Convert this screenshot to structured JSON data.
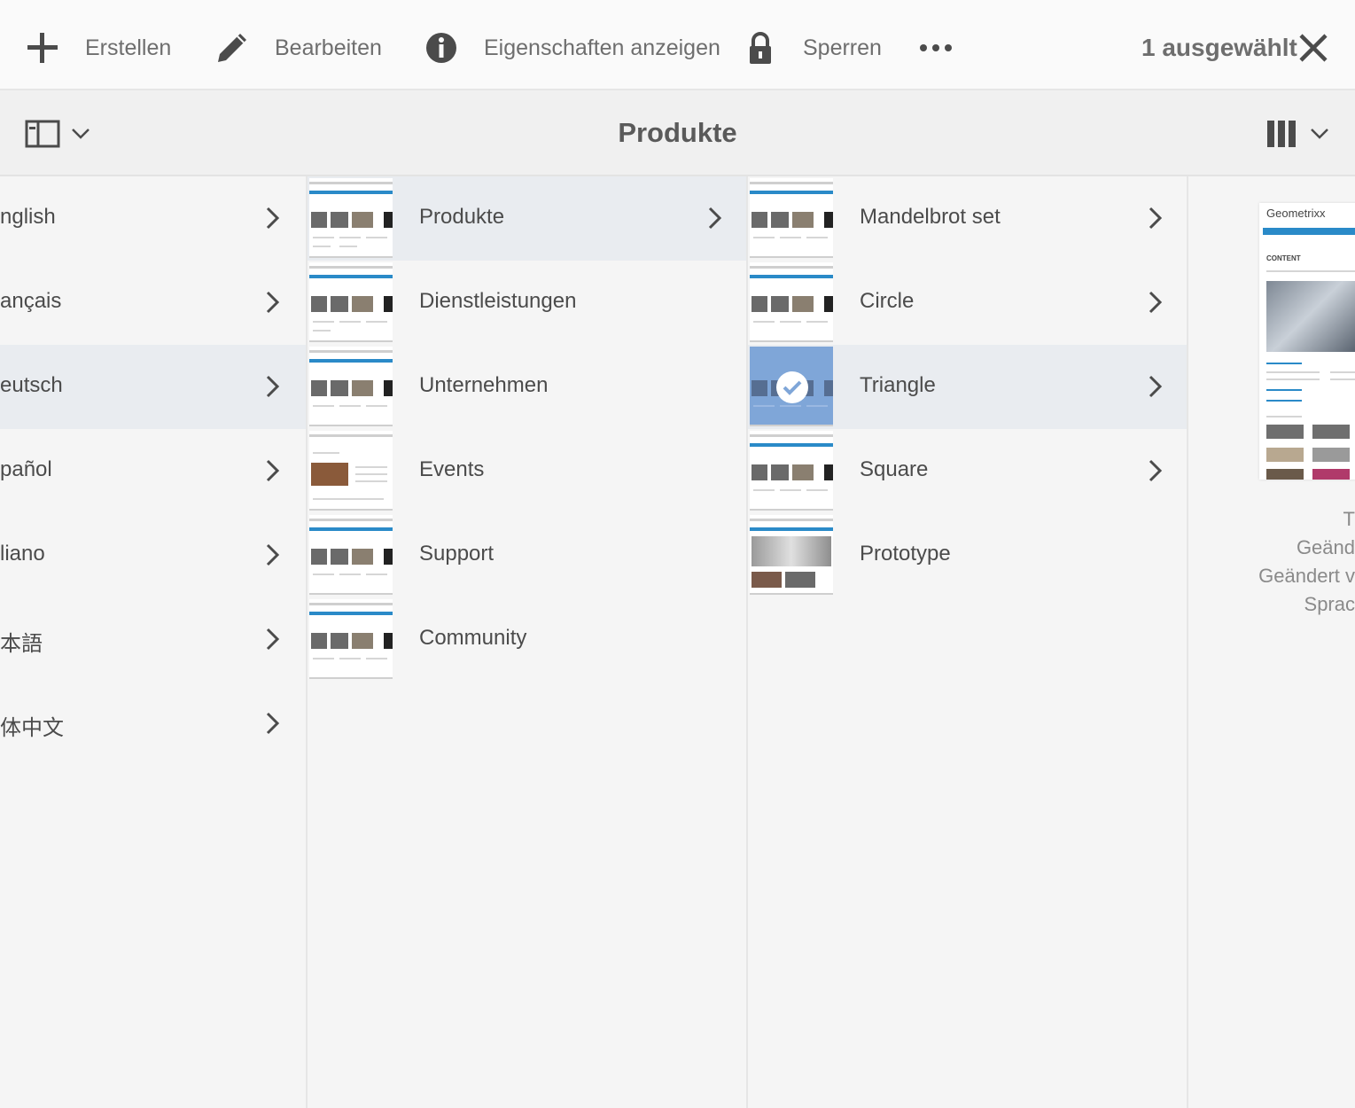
{
  "actionbar": {
    "create_label": "Erstellen",
    "edit_label": "Bearbeiten",
    "properties_label": "Eigenschaften anzeigen",
    "lock_label": "Sperren",
    "selection_count": "1 ausgewählt"
  },
  "header": {
    "title": "Produkte"
  },
  "languages": [
    {
      "label": "nglish"
    },
    {
      "label": "ançais"
    },
    {
      "label": "eutsch"
    },
    {
      "label": "pañol"
    },
    {
      "label": "liano"
    },
    {
      "label": "本語"
    },
    {
      "label": "体中文"
    }
  ],
  "sections": [
    {
      "label": "Produkte"
    },
    {
      "label": "Dienstleistungen"
    },
    {
      "label": "Unternehmen"
    },
    {
      "label": "Events"
    },
    {
      "label": "Support"
    },
    {
      "label": "Community"
    }
  ],
  "products": [
    {
      "label": "Mandelbrot set"
    },
    {
      "label": "Circle"
    },
    {
      "label": "Triangle"
    },
    {
      "label": "Square"
    },
    {
      "label": "Prototype"
    }
  ],
  "preview": {
    "brand": "Geometrixx",
    "heading": "CONTENT",
    "meta": [
      "T",
      "Geänd",
      "Geändert v",
      "Sprac"
    ]
  },
  "colors": {
    "accent_blue": "#2a8ac8",
    "selected_thumb": "#7fa6d8",
    "active_row": "#e9ecf0"
  }
}
